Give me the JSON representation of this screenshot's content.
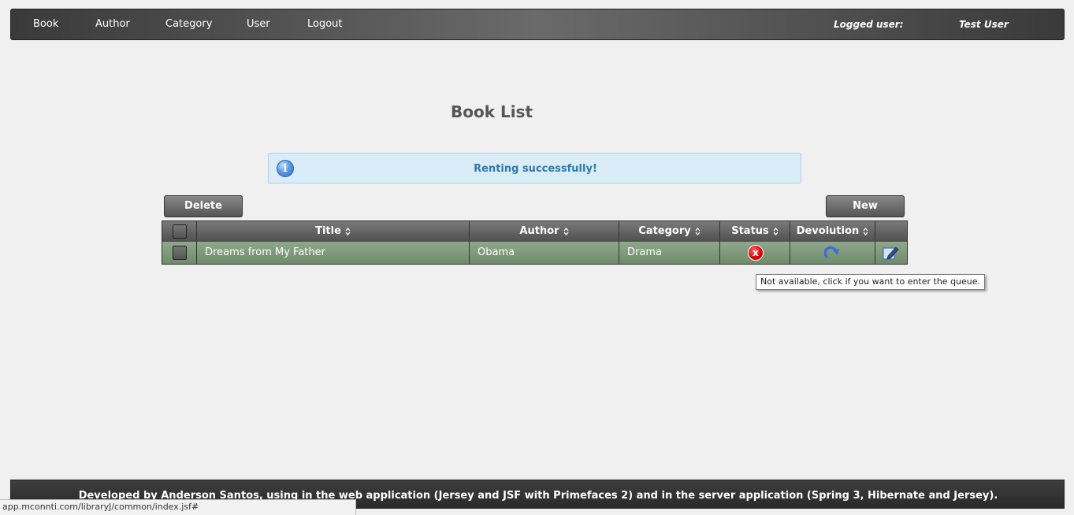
{
  "nav": {
    "items": [
      {
        "label": "Book"
      },
      {
        "label": "Author"
      },
      {
        "label": "Category"
      },
      {
        "label": "User"
      },
      {
        "label": "Logout"
      }
    ],
    "logged_user_label": "Logged user:",
    "logged_user_name": "Test User"
  },
  "page": {
    "title": "Book List"
  },
  "message": {
    "text": "Renting successfully!",
    "icon": "info-icon",
    "color": "#2e7bad"
  },
  "toolbar": {
    "delete_label": "Delete",
    "new_label": "New"
  },
  "table": {
    "headers": [
      "Title",
      "Author",
      "Category",
      "Status",
      "Devolution"
    ],
    "rows": [
      {
        "title": "Dreams from My Father",
        "author": "Obama",
        "category": "Drama",
        "status_icon": "unavailable-x-icon",
        "devolution_icon": "redo-arrow-icon",
        "edit_icon": "edit-pencil-icon"
      }
    ]
  },
  "tooltip": {
    "text": "Not available, click if you want to enter the queue."
  },
  "footer": {
    "text": "Developed by Anderson Santos, using in the web application (Jersey and JSF with Primefaces 2) and in the server application (Spring 3, Hibernate and Jersey)."
  },
  "statusbar": {
    "url": "app.mconnti.com/libraryJ/common/index.jsf#"
  }
}
